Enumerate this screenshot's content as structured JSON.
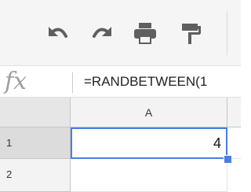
{
  "toolbar": {
    "icons": [
      "undo-icon",
      "redo-icon",
      "print-icon",
      "paint-format-icon"
    ]
  },
  "formula_bar": {
    "fx_label": "fx",
    "value": "=RANDBETWEEN(1"
  },
  "grid": {
    "column_headers": [
      "A"
    ],
    "row_headers": [
      "1",
      "2"
    ],
    "cells": {
      "A1": "4"
    }
  },
  "colors": {
    "selection": "#4a7de2",
    "icon": "#5f5f5f"
  }
}
